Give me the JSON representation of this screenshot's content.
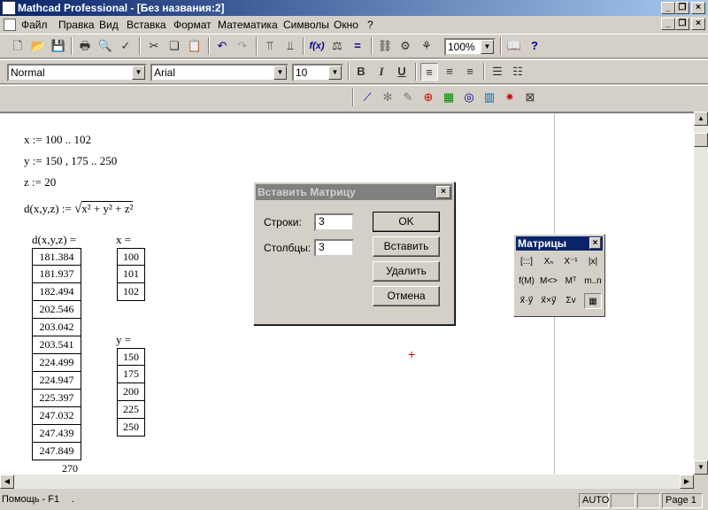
{
  "window": {
    "title": "Mathcad Professional - [Без названия:2]"
  },
  "menu": {
    "items": [
      "Файл",
      "Правка",
      "Вид",
      "Вставка",
      "Формат",
      "Математика",
      "Символы",
      "Окно",
      "?"
    ]
  },
  "toolbar": {
    "zoom": "100%"
  },
  "format_bar": {
    "style": "Normal",
    "font": "Arial",
    "size": "10",
    "bold": "B",
    "italic": "I",
    "underline": "U"
  },
  "worksheet": {
    "def_x": "x := 100 .. 102",
    "def_y": "y := 150 , 175 .. 250",
    "def_z": "z := 20",
    "def_d_lhs": "d(x,y,z) := ",
    "def_d_rhs": "x² + y² + z²",
    "eval_d_label": "d(x,y,z) =",
    "eval_x_label": "x =",
    "eval_y_label": "y =",
    "d_values": [
      "181.384",
      "181.937",
      "182.494",
      "202.546",
      "203.042",
      "203.541",
      "224.499",
      "224.947",
      "225.397",
      "247.032",
      "247.439",
      "247.849",
      "270"
    ],
    "x_values": [
      "100",
      "101",
      "102"
    ],
    "y_values": [
      "150",
      "175",
      "200",
      "225",
      "250"
    ]
  },
  "dialog": {
    "title": "Вставить Матрицу",
    "rows_label": "Строки:",
    "rows_value": "3",
    "cols_label": "Столбцы:",
    "cols_value": "3",
    "ok": "OK",
    "insert": "Вставить",
    "delete": "Удалить",
    "cancel": "Отмена"
  },
  "palette": {
    "title": "Матрицы",
    "buttons": [
      "[:::]",
      "Xₙ",
      "X⁻¹",
      "|x|",
      "f(M)",
      "M<>",
      "Mᵀ",
      "m..n",
      "x⃗·y⃗",
      "x⃗×y⃗",
      "Σv",
      "▦"
    ]
  },
  "status": {
    "help": "Помощь - F1",
    "dot": ".",
    "mode": "AUTO",
    "page": "Page 1"
  }
}
